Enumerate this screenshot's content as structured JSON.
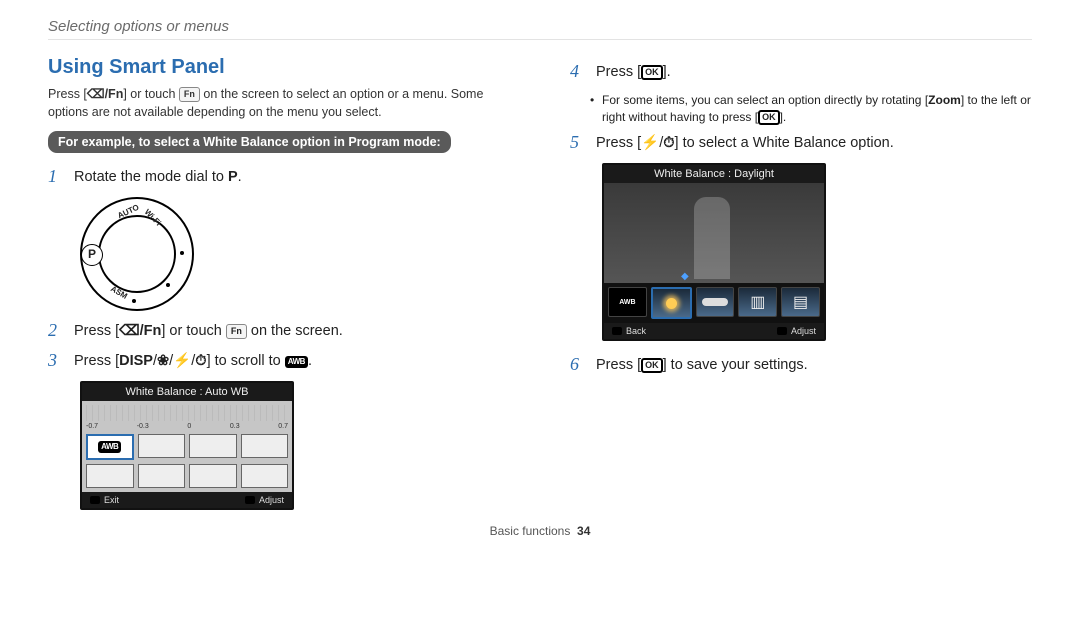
{
  "breadcrumb": "Selecting options or menus",
  "title": "Using Smart Panel",
  "intro_a": "Press [",
  "intro_b": "] or touch ",
  "intro_c": " on the screen to select an option or a menu. Some options are not available depending on the menu you select.",
  "callout": "For example, to select a White Balance option in Program mode:",
  "fn_key": "Fn",
  "trash_fn": "⌫/Fn",
  "ok_label": "OK",
  "disp_label": "DISP",
  "awb_label": "AWB",
  "zoom_label": "Zoom",
  "steps": {
    "s1_num": "1",
    "s1_a": "Rotate the mode dial to ",
    "s1_b": "P",
    "s1_c": ".",
    "s2_num": "2",
    "s2_a": "Press [",
    "s2_b": "] or touch ",
    "s2_c": " on the screen.",
    "s3_num": "3",
    "s3_a": "Press [",
    "s3_b": "] to scroll to ",
    "s3_c": ".",
    "s4_num": "4",
    "s4_a": "Press [",
    "s4_b": "].",
    "s4_sub_a": "For some items, you can select an option directly by rotating [",
    "s4_sub_b": "] to the left or right without having to press [",
    "s4_sub_c": "].",
    "s5_num": "5",
    "s5_a": "Press [",
    "s5_b": "] to select a White Balance option.",
    "s6_num": "6",
    "s6_a": "Press [",
    "s6_b": "] to save your settings."
  },
  "lcd1": {
    "title": "White Balance : Auto WB",
    "scale_labels": [
      "-0.7",
      "-0.3",
      "0",
      "0.3",
      "0.7"
    ],
    "exit": "Exit",
    "adjust": "Adjust"
  },
  "lcd2": {
    "title": "White Balance : Daylight",
    "back": "Back",
    "adjust": "Adjust"
  },
  "dial": {
    "asm": "ASM",
    "wifi": "Wi-Fi",
    "auto": "AUTO",
    "P": "P"
  },
  "footer_section": "Basic functions",
  "footer_page": "34",
  "flash_timer_sep": "/"
}
